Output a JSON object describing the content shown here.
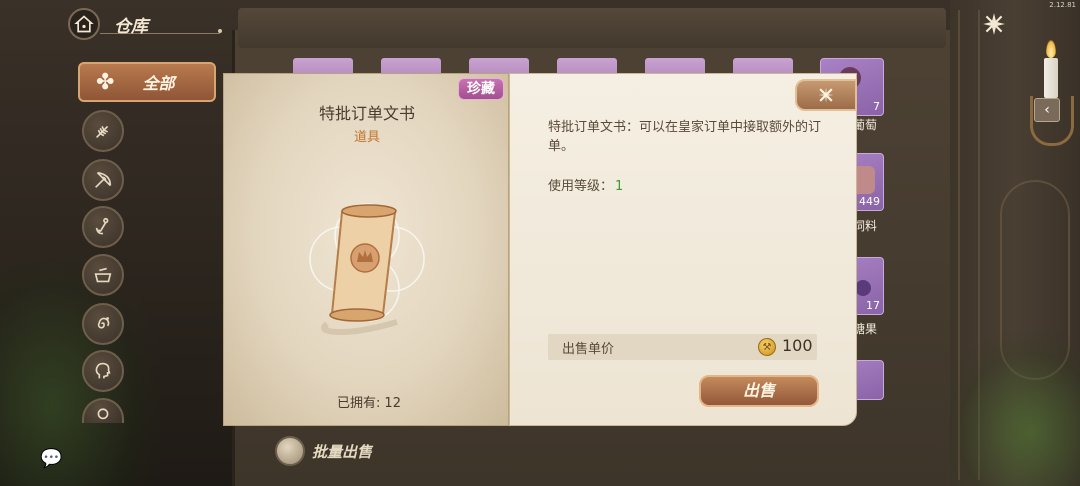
{
  "version": "2.12.81",
  "header": {
    "title": "仓库",
    "home_icon": "house-icon"
  },
  "sidebar": {
    "active_label": "全部",
    "active_icon": "clover-icon",
    "items": [
      {
        "icon": "wheat-icon"
      },
      {
        "icon": "bow-icon"
      },
      {
        "icon": "anchor-icon"
      },
      {
        "icon": "cooking-pot-icon"
      },
      {
        "icon": "spiral-icon"
      },
      {
        "icon": "head-profile-icon"
      },
      {
        "icon": "partial-icon"
      }
    ]
  },
  "background_grid": {
    "items": [
      {
        "count": "7",
        "name": "葡萄"
      },
      {
        "count": "449",
        "name": "饲料"
      },
      {
        "count": "17",
        "name": "糖果"
      }
    ]
  },
  "detail": {
    "rarity_tag": "珍藏",
    "item_name": "特批订单文书",
    "item_type": "道具",
    "owned_label": "已拥有:",
    "owned_count": "12",
    "description": "特批订单文书：可以在皇家订单中接取额外的订单。",
    "level_label": "使用等级：",
    "level_value": "1",
    "price_label": "出售单价",
    "price_value": "100",
    "sell_label": "出售",
    "colors": {
      "rare_tag": "#b45fa0",
      "item_type": "#c0742e",
      "level_value": "#3d9a2e"
    }
  },
  "bottom": {
    "batch_sell_label": "批量出售",
    "chat_icon": "chat-bubble-icon"
  }
}
